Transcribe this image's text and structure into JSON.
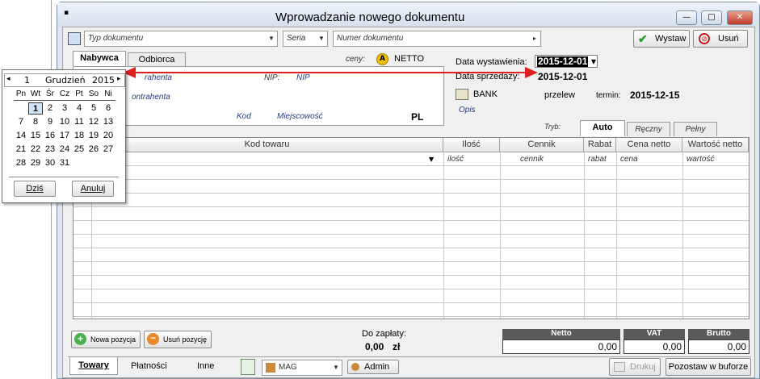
{
  "window": {
    "title": "Wprowadzanie nowego dokumentu",
    "min": "▭",
    "max": "▭",
    "close": "✕"
  },
  "toolbar": {
    "doc_type_placeholder": "Typ dokumentu",
    "series_placeholder": "Seria",
    "number_placeholder": "Numer dokumentu",
    "issue_label": "Wystaw",
    "delete_label": "Usuń"
  },
  "party_tabs": {
    "buyer": "Nabywca",
    "recipient": "Odbiorca"
  },
  "prices": {
    "label": "ceny:",
    "badge": "A",
    "mode": "NETTO"
  },
  "buyer": {
    "name_placeholder": "rahenta",
    "nip_label": "NIP:",
    "nip_placeholder": "NIP",
    "addr_placeholder": "ontrahenta",
    "kod_placeholder": "Kod",
    "city_placeholder": "Miejscowość",
    "country": "PL"
  },
  "dates": {
    "issue_label": "Data wystawienia:",
    "issue_value": "2015-12-01",
    "sale_label": "Data sprzedaży:",
    "sale_value": "2015-12-01"
  },
  "payment": {
    "bank": "BANK",
    "method": "przelew",
    "due_label": "termin:",
    "due_value": "2015-12-15",
    "note_placeholder": "Opis"
  },
  "mode_tabs": {
    "label": "Tryb:",
    "auto": "Auto",
    "manual": "Ręczny",
    "full": "Pełny"
  },
  "grid": {
    "columns": [
      "Kod towaru",
      "Ilość",
      "Cennik",
      "Rabat",
      "Cena netto",
      "Wartość netto"
    ],
    "placeholders": [
      "",
      "ilość",
      "cennik",
      "rabat",
      "cena",
      "wartość"
    ]
  },
  "bottom": {
    "new_position": "Nowa pozycja",
    "delete_position": "Usuń pozycję",
    "to_pay_label": "Do zapłaty:",
    "to_pay_value": "0,00",
    "currency": "zł",
    "netto_label": "Netto",
    "netto_value": "0,00",
    "vat_label": "VAT",
    "vat_value": "0,00",
    "brutto_label": "Brutto",
    "brutto_value": "0,00"
  },
  "footer": {
    "tab_goods": "Towary",
    "tab_payments": "Płatności",
    "tab_other": "Inne",
    "warehouse": "MAG",
    "user": "Admin",
    "print": "Drukuj",
    "save_buffer": "Pozostaw w buforze"
  },
  "calendar": {
    "day": "1",
    "month": "Grudzień",
    "year": "2015",
    "weekdays": [
      "Pn",
      "Wt",
      "Śr",
      "Cz",
      "Pt",
      "So",
      "Ni"
    ],
    "weeks": [
      [
        "",
        "1",
        "2",
        "3",
        "4",
        "5",
        "6"
      ],
      [
        "7",
        "8",
        "9",
        "10",
        "11",
        "12",
        "13"
      ],
      [
        "14",
        "15",
        "16",
        "17",
        "18",
        "19",
        "20"
      ],
      [
        "21",
        "22",
        "23",
        "24",
        "25",
        "26",
        "27"
      ],
      [
        "28",
        "29",
        "30",
        "31",
        "",
        "",
        ""
      ]
    ],
    "today": "Dziś",
    "cancel": "Anuluj"
  },
  "colors": {
    "arrow": "#e02020",
    "accent": "#f0c000"
  }
}
